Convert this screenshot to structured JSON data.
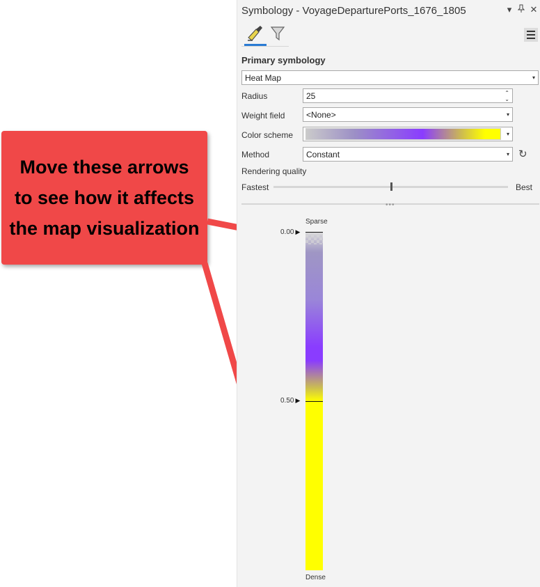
{
  "panel": {
    "title": "Symbology - VoyageDeparturePorts_1676_1805",
    "window_buttons": [
      "▾",
      "⊥",
      "✕"
    ],
    "tabs": [
      {
        "name": "primary-symbology-tab",
        "icon": "paintbrush-icon",
        "active": true
      },
      {
        "name": "vary-symbology-tab",
        "icon": "funnel-icon",
        "active": false
      }
    ],
    "section_title": "Primary symbology",
    "renderer": "Heat Map",
    "fields": {
      "radius_label": "Radius",
      "radius_value": "25",
      "weight_label": "Weight field",
      "weight_value": "<None>",
      "color_label": "Color scheme",
      "method_label": "Method",
      "method_value": "Constant"
    },
    "quality": {
      "label": "Rendering quality",
      "min_label": "Fastest",
      "max_label": "Best",
      "level": 0.5
    },
    "ramp": {
      "top_label": "Sparse",
      "bottom_label": "Dense",
      "stops": [
        {
          "label": "0.00",
          "position": 0.0
        },
        {
          "label": "0.50",
          "position": 0.5
        }
      ]
    },
    "colors": {
      "accent": "#2a7bd4",
      "purple": "#8a3cff",
      "yellow": "#ffff00",
      "callout": "#f04848"
    }
  },
  "callout": {
    "text": "Move these arrows to see how it affects the map visualization"
  }
}
